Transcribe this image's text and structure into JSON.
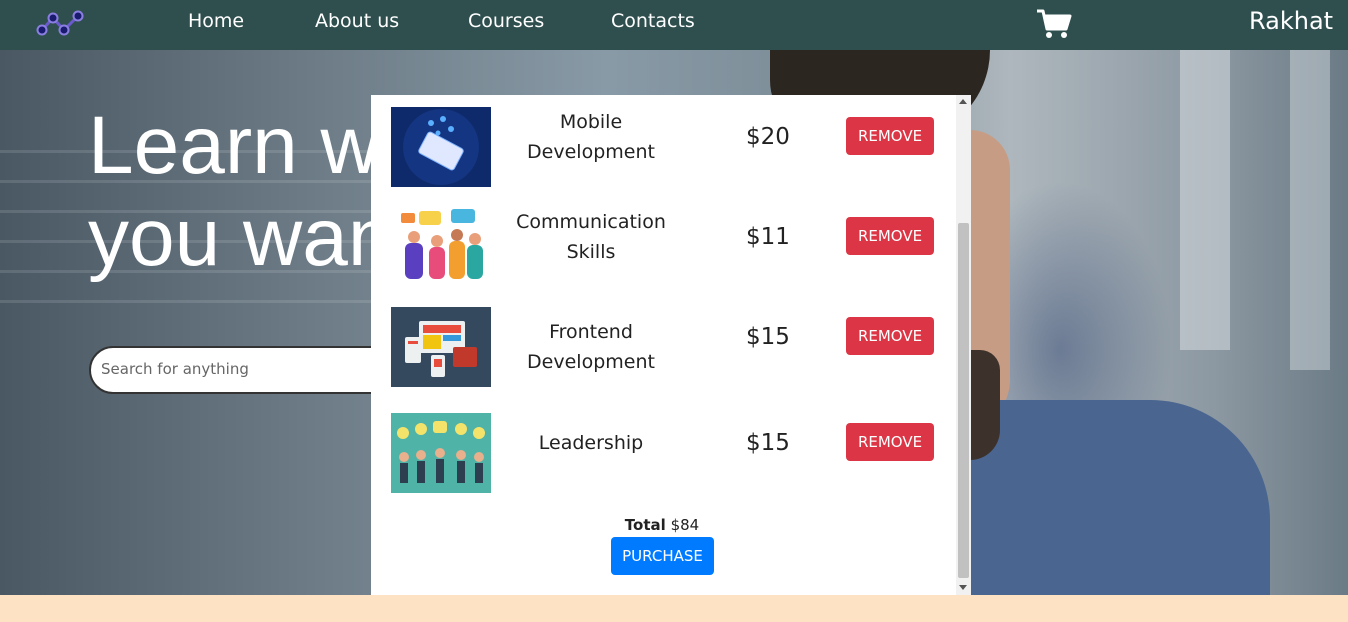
{
  "nav": {
    "links": [
      "Home",
      "About us",
      "Courses",
      "Contacts"
    ],
    "user_name": "Rakhat",
    "cart_icon": "shopping-cart-icon",
    "logo_icon": "network-graph-logo-icon",
    "brand_color": "#2f4f4f"
  },
  "hero": {
    "title_line1": "Learn w",
    "title_line2": "you wan",
    "search": {
      "placeholder": "Search for anything",
      "value": ""
    }
  },
  "cart": {
    "items": [
      {
        "name": "Mobile Development",
        "price": "$20",
        "remove_label": "REMOVE",
        "thumb": "mobile-phone-illustration"
      },
      {
        "name": "Communication Skills",
        "price": "$11",
        "remove_label": "REMOVE",
        "thumb": "people-talking-illustration"
      },
      {
        "name": "Frontend Development",
        "price": "$15",
        "remove_label": "REMOVE",
        "thumb": "web-design-illustration"
      },
      {
        "name": "Leadership",
        "price": "$15",
        "remove_label": "REMOVE",
        "thumb": "team-lightbulbs-illustration"
      }
    ],
    "total_label": "Total",
    "total_value": "$84",
    "purchase_label": "PURCHASE",
    "remove_color": "#dc3545",
    "purchase_color": "#007bff"
  }
}
